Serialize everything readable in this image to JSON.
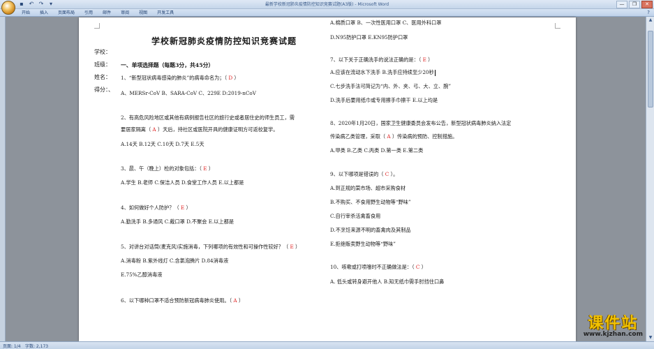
{
  "window": {
    "title": "最新学校新冠肺炎疫情防控知识竞赛试题(A3版) - Microsoft Word",
    "qat": [
      "save-icon",
      "undo-icon",
      "redo-icon",
      "customize-icon"
    ],
    "controls": [
      "—",
      "❐",
      "✕"
    ]
  },
  "ribbon": {
    "tabs": [
      "开始",
      "插入",
      "页面布局",
      "引用",
      "邮件",
      "审阅",
      "视图",
      "开发工具"
    ],
    "help": "?"
  },
  "document": {
    "title": "学校新冠肺炎疫情防控知识竞赛试题",
    "side_labels": [
      "学校：",
      "班级：",
      "姓名：",
      "得分：、"
    ],
    "left": [
      {
        "text": "一、单项选择题（每题3分，共45分）",
        "section": true
      },
      {
        "pre": "1、“新型冠状病毒感染的肺炎”的病毒命名为；（ ",
        "ans": "D",
        "post": " ）"
      },
      {
        "text": "A、MERSr-CoV  B、SARA-CoV  C、229E  D:2019-nCoV"
      },
      {
        "text": "2、有高危风险地区或其他有病例报告社区的旅行史或者居住史的师生员工，需"
      },
      {
        "pre": "要居家隔离（ ",
        "ans": "A",
        "post": " ）天后，持社区或医院开具的健康证明方可返校复学。"
      },
      {
        "text": "A.14天    B.12天     C.10天      D.7天     E.5天"
      },
      {
        "pre": "3、晨、午（晚上）检的对象包括：（ ",
        "ans": "E",
        "post": " ）"
      },
      {
        "text": "A.学生  B.老师  C.保洁人员  D.食堂工作人员  E.以上都是"
      },
      {
        "pre": "4、如何做好个人防护？（ ",
        "ans": "E",
        "post": " ）"
      },
      {
        "text": "A.勤洗手  B.多通风  C.戴口罩  D.不聚会  E.以上都是"
      },
      {
        "pre": "5、对讲台对话筒(麦克风)实施消毒，下列哪项的有效性和可操作性较好？（ ",
        "ans": "E",
        "post": " ）"
      },
      {
        "text": "A.消毒粉  B.紫外线灯  C.含氯泡腾片  D.84消毒液"
      },
      {
        "text": "E.75%乙醇消毒液"
      },
      {
        "pre": "6、以下哪种口罩不适合预防新冠病毒肺炎使用。（ ",
        "ans": "A",
        "post": " ）"
      }
    ],
    "right": [
      {
        "text": "A.棉质口罩   B、一次性医用口罩   C、医用外科口罩"
      },
      {
        "text": "D.N95防护口罩  E.KN95防护口罩"
      },
      {
        "pre": "7、以下关于正确洗手的说法正确的是：（ ",
        "ans": "E",
        "post": " ）"
      },
      {
        "text": "A.应该在流动水下洗手      B.洗手应持续至少20秒",
        "cursor": true
      },
      {
        "text": "C.七步洗手法可简记为“内、外、夹、弓、大、立、腕”"
      },
      {
        "text": "D.洗手后要用纸巾或专用擦手巾擦干      E.以上均是"
      },
      {
        "text": "8、2020年1月20日，国家卫生健康委员会发布公告，新型冠状病毒肺炎纳入法定"
      },
      {
        "pre": "传染病乙类管理，采取（ ",
        "ans": "A",
        "post": " ）传染病的预防、控制措施。"
      },
      {
        "text": "A.甲类  B.乙类  C.丙类  D.第一类  E.第二类"
      },
      {
        "pre": "9、以下哪项是错误的（  ",
        "ans": "C",
        "post": "  ）。"
      },
      {
        "text": "A.到正规的菜市场、超市采购食材"
      },
      {
        "text": "B.不购买、不食用野生动物等“野味”"
      },
      {
        "text": "C.自行宰杀活禽畜食用"
      },
      {
        "text": "D.不烹饪来源不明的畜禽肉及其制品"
      },
      {
        "text": "E.拒绝贩卖野生动物等“野味”"
      },
      {
        "pre": "10、咳嗽或打喷嚏时不正确做法是：（ ",
        "ans": "C",
        "post": " ）"
      },
      {
        "text": "A. 低头或转身避开他人          B.知无纸巾需手肘挡住口鼻"
      }
    ]
  },
  "status": {
    "page": "页面: 1/4",
    "words": "字数: 2,173"
  },
  "watermark": {
    "big": "课件站",
    "small": "www.kjzhan.com"
  },
  "colors": {
    "answer": "#e02020",
    "workspace": "#8d939b"
  }
}
